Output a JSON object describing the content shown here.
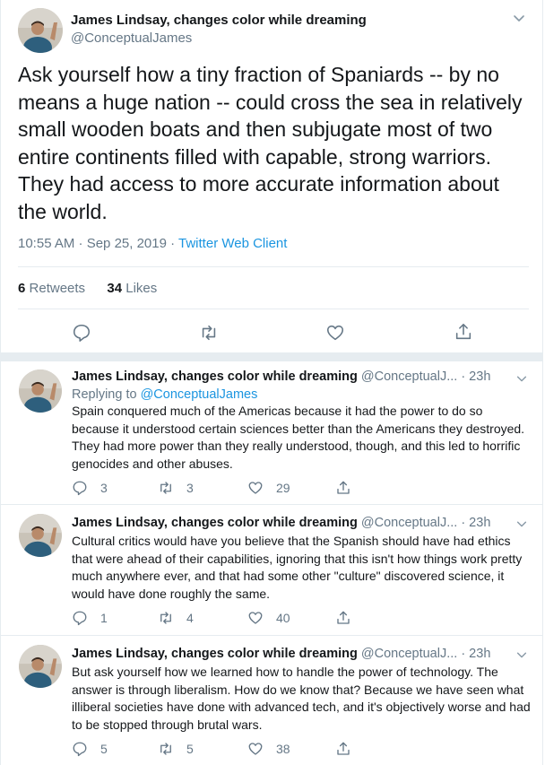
{
  "main_tweet": {
    "author_name": "James Lindsay, changes color while dreaming",
    "handle": "@ConceptualJames",
    "text": "Ask yourself how a tiny fraction of Spaniards -- by no means a huge nation -- could cross the sea in relatively small wooden boats and then subjugate most of two entire continents filled with capable, strong warriors. They had access to more accurate information about the world.",
    "timestamp": "10:55 AM · Sep 25, 2019 · ",
    "client": "Twitter Web Client",
    "retweets_count": "6",
    "retweets_label": "Retweets",
    "likes_count": "34",
    "likes_label": "Likes",
    "icons": [
      "reply-icon",
      "retweet-icon",
      "like-icon",
      "share-icon"
    ]
  },
  "replies": [
    {
      "author_name": "James Lindsay, changes color while dreaming",
      "handle": "@ConceptualJ...",
      "time": "· 23h",
      "replying_label": "Replying to ",
      "replying_to": "@ConceptualJames",
      "text": "Spain conquered much of the Americas because it had the power to do so because it understood certain sciences better than the Americans they destroyed. They had more power than they really understood, though, and this led to horrific genocides and other abuses.",
      "reply_count": "3",
      "retweet_count": "3",
      "like_count": "29"
    },
    {
      "author_name": "James Lindsay, changes color while dreaming",
      "handle": "@ConceptualJ...",
      "time": "· 23h",
      "text": "Cultural critics would have you believe that the Spanish should have had ethics that were ahead of their capabilities, ignoring that this isn't how things work pretty much anywhere ever, and that had some other \"culture\" discovered science, it would have done roughly the same.",
      "reply_count": "1",
      "retweet_count": "4",
      "like_count": "40"
    },
    {
      "author_name": "James Lindsay, changes color while dreaming",
      "handle": "@ConceptualJ...",
      "time": "· 23h",
      "text": "But ask yourself how we learned how to handle the power of technology. The answer is through liberalism. How do we know that? Because we have seen what illiberal societies have done with advanced tech, and it's objectively worse and had to be stopped through brutal wars.",
      "reply_count": "5",
      "retweet_count": "5",
      "like_count": "38"
    }
  ],
  "colors": {
    "text": "#14171a",
    "secondary": "#657786",
    "link": "#1b95e0",
    "divider": "#e6ecf0"
  }
}
